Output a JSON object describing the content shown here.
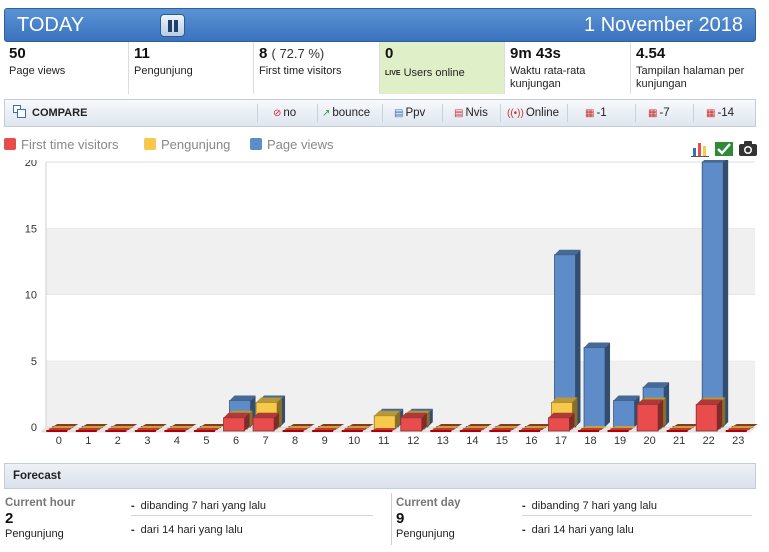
{
  "header": {
    "title": "TODAY",
    "date": "1 November 2018",
    "bg_color": "#4a82c9"
  },
  "stats": [
    {
      "value": "50",
      "pct": "",
      "label": "Page views"
    },
    {
      "value": "11",
      "pct": "",
      "label": "Pengunjung"
    },
    {
      "value": "8",
      "pct": "( 72.7 %)",
      "label": "First time visitors"
    },
    {
      "value": "0",
      "pct": "",
      "label": "Users online",
      "highlight": "#dff0c8"
    },
    {
      "value": "9m 43s",
      "pct": "",
      "label": "Waktu rata-rata kunjungan"
    },
    {
      "value": "4.54",
      "pct": "",
      "label": "Tampilan halaman per kunjungan"
    }
  ],
  "compare": {
    "label": "COMPARE",
    "items": [
      {
        "label": "no",
        "icon": "no-entry-icon"
      },
      {
        "label": "bounce",
        "icon": "bounce-icon"
      },
      {
        "label": "Ppv",
        "icon": "chart-icon"
      },
      {
        "label": "Nvis",
        "icon": "chart-icon"
      },
      {
        "label": "Online",
        "icon": "broadcast-icon"
      },
      {
        "label": "-1",
        "icon": "calendar-icon"
      },
      {
        "label": "-7",
        "icon": "calendar-icon"
      },
      {
        "label": "-14",
        "icon": "calendar-icon"
      }
    ]
  },
  "chart_data": {
    "type": "bar",
    "title": "",
    "xlabel": "",
    "ylabel": "",
    "ylim": [
      0,
      20
    ],
    "yticks": [
      0,
      5,
      10,
      15,
      20
    ],
    "grid": true,
    "legend_position": "top-left",
    "categories": [
      "0",
      "1",
      "2",
      "3",
      "4",
      "5",
      "6",
      "7",
      "8",
      "9",
      "10",
      "11",
      "12",
      "13",
      "14",
      "15",
      "16",
      "17",
      "18",
      "19",
      "20",
      "21",
      "22",
      "23"
    ],
    "series": [
      {
        "name": "First time visitors",
        "color": "#e84c4c",
        "values": [
          0,
          0,
          0,
          0,
          0,
          0,
          1,
          1,
          0,
          0,
          0,
          0,
          1,
          0,
          0,
          0,
          0,
          1,
          0,
          0,
          2,
          0,
          2,
          0
        ]
      },
      {
        "name": "Pengunjung",
        "color": "#f7c94b",
        "values": [
          0,
          0,
          0,
          0,
          0,
          0,
          1,
          2,
          0,
          0,
          0,
          1,
          1,
          0,
          0,
          0,
          0,
          2,
          0,
          0,
          2,
          0,
          2,
          0
        ]
      },
      {
        "name": "Page views",
        "color": "#5d8cc8",
        "values": [
          0,
          0,
          0,
          0,
          0,
          0,
          2,
          2,
          0,
          0,
          0,
          1,
          1,
          0,
          0,
          0,
          0,
          13,
          6,
          2,
          3,
          0,
          20,
          0
        ]
      }
    ]
  },
  "tools": [
    {
      "name": "bar-chart-icon"
    },
    {
      "name": "check-chart-icon"
    },
    {
      "name": "camera-icon"
    }
  ],
  "forecast": {
    "title": "Forecast",
    "hour": {
      "label": "Current hour",
      "value": "2",
      "unit": "Pengunjung",
      "cmp7": "dibanding 7 hari yang lalu",
      "cmp14": "dari 14 hari yang lalu"
    },
    "day": {
      "label": "Current day",
      "value": "9",
      "unit": "Pengunjung",
      "cmp7": "dibanding 7 hari yang lalu",
      "cmp14": "dari 14 hari yang lalu"
    }
  }
}
